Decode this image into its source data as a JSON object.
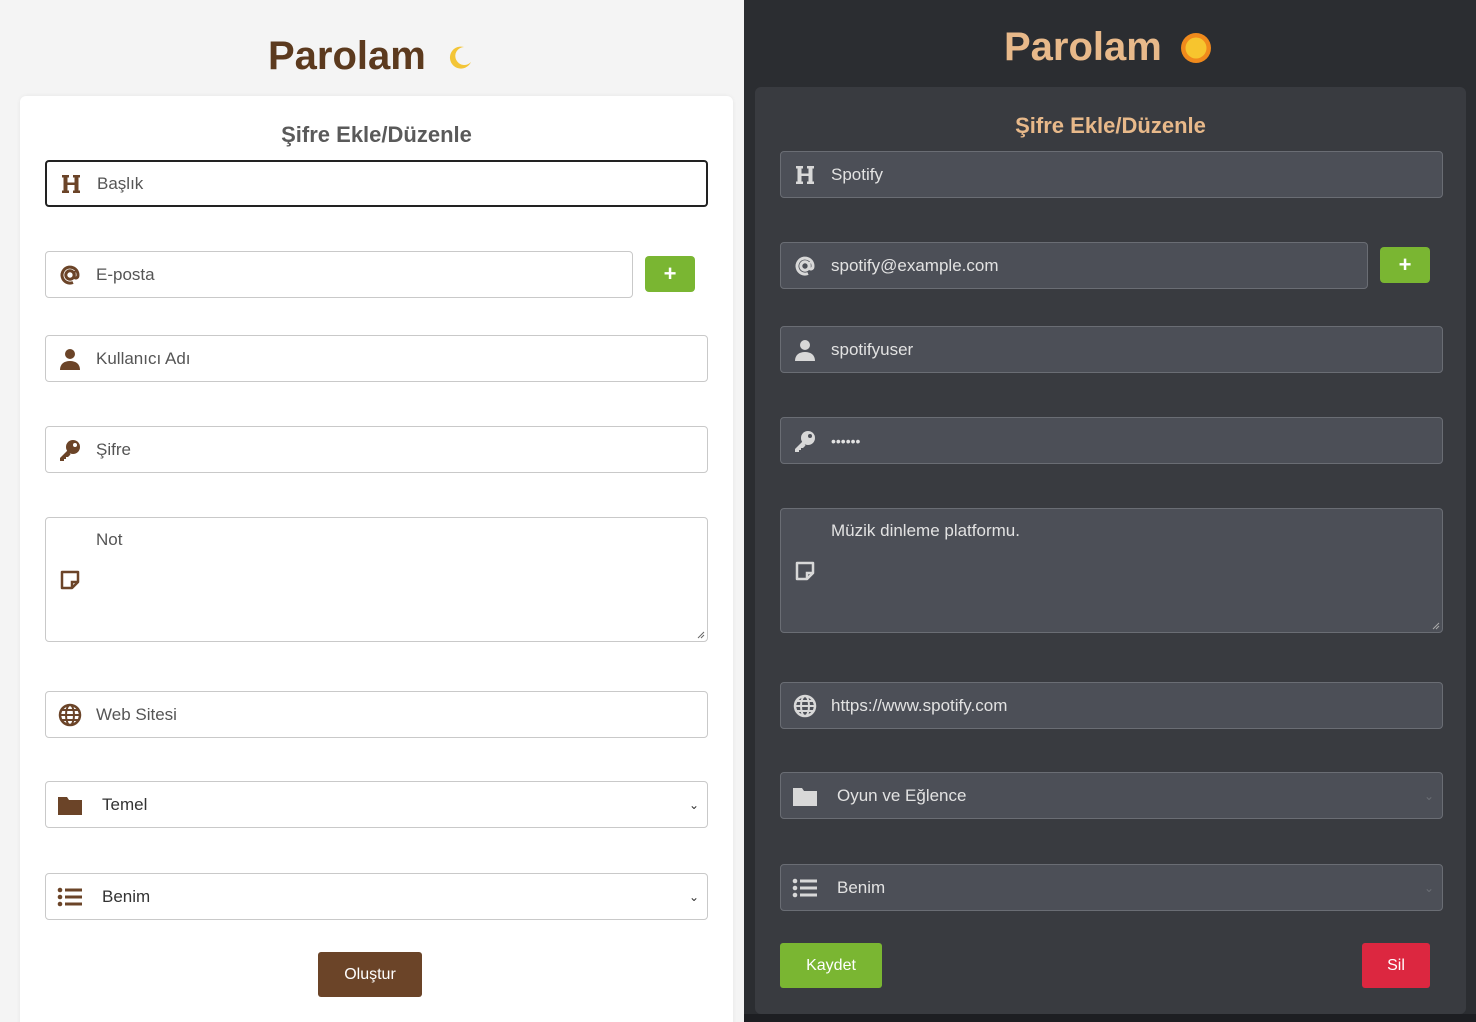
{
  "light": {
    "app_title": "Parolam",
    "theme_toggle_icon": "moon-icon",
    "form_title": "Şifre Ekle/Düzenle",
    "fields": {
      "title_placeholder": "Başlık",
      "email_placeholder": "E-posta",
      "username_placeholder": "Kullanıcı Adı",
      "password_placeholder": "Şifre",
      "note_placeholder": "Not",
      "website_placeholder": "Web Sitesi",
      "category_selected": "Temel",
      "list_selected": "Benim"
    },
    "add_email_label": "+",
    "create_button_label": "Oluştur"
  },
  "dark": {
    "app_title": "Parolam",
    "theme_toggle_icon": "sun-icon",
    "form_title": "Şifre Ekle/Düzenle",
    "fields": {
      "title_value": "Spotify",
      "email_value": "spotify@example.com",
      "username_value": "spotifyuser",
      "password_value": "••••••",
      "note_value": "Müzik dinleme platformu.",
      "website_value": "https://www.spotify.com",
      "category_selected": "Oyun ve Eğlence",
      "list_selected": "Benim"
    },
    "add_email_label": "+",
    "save_button_label": "Kaydet",
    "delete_button_label": "Sil"
  },
  "colors": {
    "brown_accent": "#6b4428",
    "green_button": "#7ab632",
    "red_button": "#dc2740",
    "dark_title": "#e8b98a"
  }
}
